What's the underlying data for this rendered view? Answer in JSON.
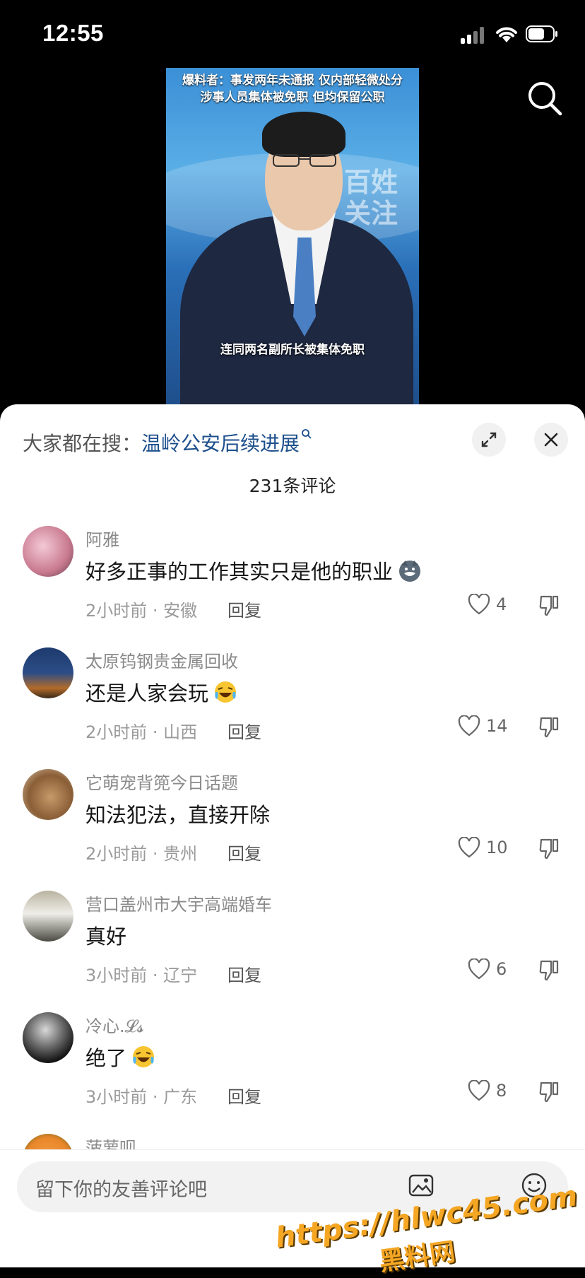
{
  "status_bar": {
    "time": "12:55"
  },
  "video": {
    "headline_line1": "爆料者：事发两年未通报 仅内部轻微处分",
    "headline_line2": "涉事人员集体被免职 但均保留公职",
    "watermark": "百姓关注",
    "subtitle": "连同两名副所长被集体免职"
  },
  "search": {
    "prefix": "大家都在搜：",
    "term": "温岭公安后续进展"
  },
  "comment_count": "231条评论",
  "comments": [
    {
      "name": "阿雅",
      "text": "好多正事的工作其实只是他的职业",
      "emoji": "wolf-emoji",
      "meta": "2小时前 · 安徽",
      "reply": "回复",
      "likes": "4",
      "avatar_color": "#c97a8f"
    },
    {
      "name": "太原钨钢贵金属回收",
      "text": "还是人家会玩",
      "emoji": "laughing-emoji",
      "meta": "2小时前 · 山西",
      "reply": "回复",
      "likes": "14",
      "avatar_color": "#1e3a6e"
    },
    {
      "name": "它萌宠背篼今日话题",
      "text": "知法犯法，直接开除",
      "emoji": "",
      "meta": "2小时前 · 贵州",
      "reply": "回复",
      "likes": "10",
      "avatar_color": "#a57a52"
    },
    {
      "name": "营口盖州市大宇高端婚车",
      "text": "真好",
      "emoji": "",
      "meta": "3小时前 · 辽宁",
      "reply": "回复",
      "likes": "6",
      "avatar_color": "#6b6b5e"
    },
    {
      "name": "冷心.𝓛𝓼",
      "text": "绝了",
      "emoji": "laughing-emoji",
      "meta": "3小时前 · 广东",
      "reply": "回复",
      "likes": "8",
      "avatar_color": "#2a2a2a"
    }
  ],
  "partial_comment": {
    "name": "菠萝呗",
    "avatar_color": "#e8862a"
  },
  "input": {
    "placeholder": "留下你的友善评论吧"
  },
  "overlay_watermark": {
    "site": "https://hlwc45.com",
    "label": "黑料网"
  }
}
